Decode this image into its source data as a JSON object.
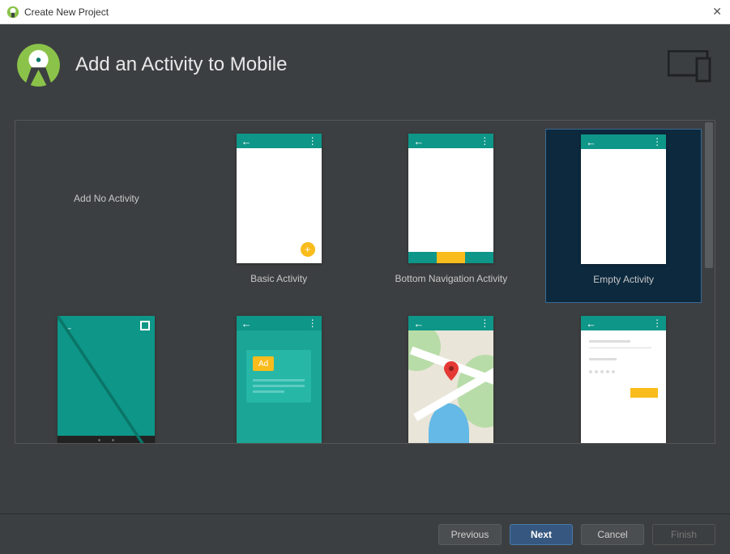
{
  "window": {
    "title": "Create New Project"
  },
  "header": {
    "title": "Add an Activity to Mobile"
  },
  "templates": {
    "none_label": "Add No Activity",
    "basic_label": "Basic Activity",
    "bottom_nav_label": "Bottom Navigation Activity",
    "empty_label": "Empty Activity",
    "ad_text": "Ad"
  },
  "footer": {
    "previous": "Previous",
    "next": "Next",
    "cancel": "Cancel",
    "finish": "Finish"
  }
}
